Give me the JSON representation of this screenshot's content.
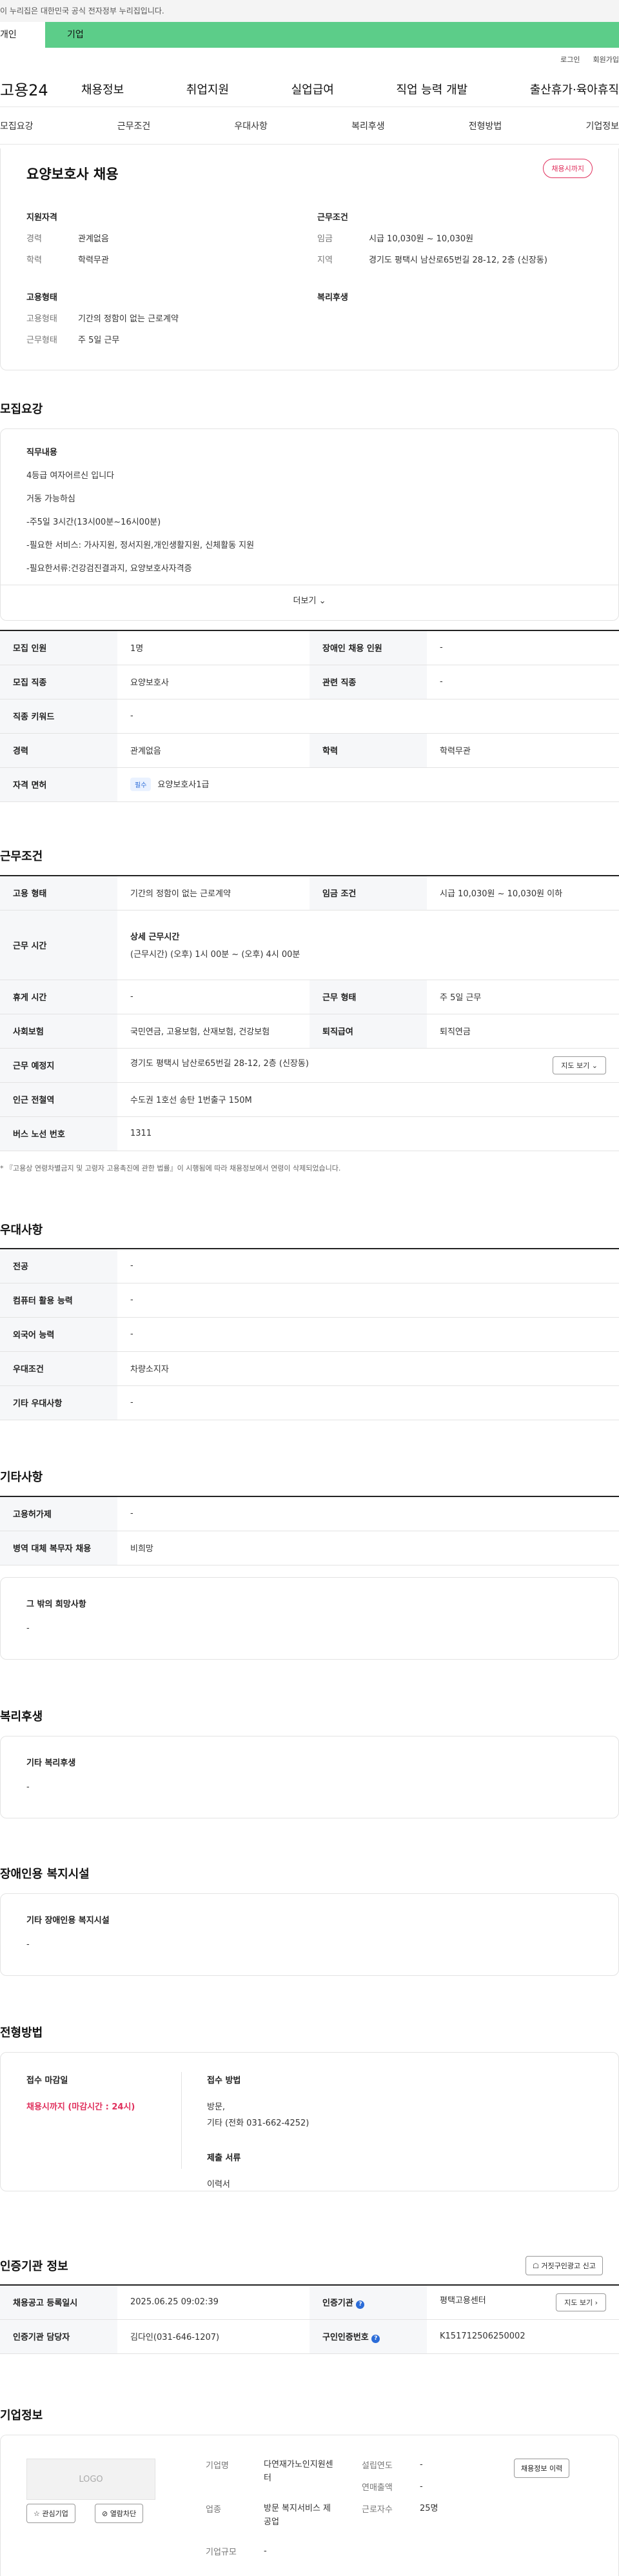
{
  "notice": "이 누리집은 대한민국 공식 전자정부 누리집입니다.",
  "top_tabs": [
    "개인",
    "기업"
  ],
  "utility": [
    "로그인",
    "회원가입"
  ],
  "logo": "고용24",
  "gnb": [
    "채용정보",
    "취업지원",
    "실업급여",
    "직업 능력 개발",
    "출산휴가·육아휴직"
  ],
  "subnav": [
    "모집요강",
    "근무조건",
    "우대사항",
    "복리후생",
    "전형방법",
    "기업정보"
  ],
  "summary": {
    "title": "요양보호사 채용",
    "badge": "채용시까지",
    "qualification": {
      "heading": "지원자격",
      "rows": [
        {
          "k": "경력",
          "v": "관계없음"
        },
        {
          "k": "학력",
          "v": "학력무관"
        }
      ]
    },
    "conditions": {
      "heading": "근무조건",
      "rows": [
        {
          "k": "임금",
          "v": "시급 10,030원 ~ 10,030원"
        },
        {
          "k": "지역",
          "v": "경기도 평택시 남산로65번길 28-12, 2층 (신장동)"
        }
      ]
    },
    "employment": {
      "heading": "고용형태",
      "rows": [
        {
          "k": "고용형태",
          "v": "기간의 정함이 없는 근로계약"
        },
        {
          "k": "근무형태",
          "v": "주 5일 근무"
        }
      ]
    },
    "welfare_heading": "복리후생"
  },
  "recruit": {
    "title": "모집요강",
    "desc_head": "직무내용",
    "desc_lines": [
      "4등급 여자어르신 입니다",
      "거동 가능하심",
      "-주5일  3시간(13시00분~16시00분)",
      "-필요한 서비스: 가사지원, 정서지원,개인생활지원, 신체활동 지원",
      "-필요한서류:건강검진결과지, 요양보호사자격증"
    ],
    "more": "더보기",
    "table": {
      "r1": {
        "k1": "모집 인원",
        "v1": "1명",
        "k2": "장애인 채용 인원",
        "v2": "-"
      },
      "r2": {
        "k1": "모집 직종",
        "v1": "요양보호사",
        "k2": "관련 직종",
        "v2": "-"
      },
      "r3": {
        "k1": "직종 키워드",
        "v1": "-"
      },
      "r4": {
        "k1": "경력",
        "v1": "관계없음",
        "k2": "학력",
        "v2": "학력무관"
      },
      "r5": {
        "k1": "자격 면허",
        "chip": "필수",
        "v1": "요양보호사1급"
      }
    }
  },
  "work": {
    "title": "근무조건",
    "r1": {
      "k1": "고용 형태",
      "v1": "기간의 정함이 없는 근로계약",
      "k2": "임금 조건",
      "v2": "시급 10,030원 ~ 10,030원 이하"
    },
    "r2": {
      "k1": "근무 시간",
      "detail_head": "상세 근무시간",
      "detail": "(근무시간) (오후) 1시 00분 ~ (오후) 4시 00분"
    },
    "r3": {
      "k1": "휴게 시간",
      "v1": "-",
      "k2": "근무 형태",
      "v2": "주 5일 근무"
    },
    "r4": {
      "k1": "사회보험",
      "v1": "국민연금, 고용보험, 산재보험, 건강보험",
      "k2": "퇴직급여",
      "v2": "퇴직연금"
    },
    "r5": {
      "k1": "근무 예정지",
      "v1": "경기도 평택시 남산로65번길 28-12, 2층 (신장동)",
      "btn": "지도 보기"
    },
    "r6": {
      "k1": "인근 전철역",
      "v1": "수도권 1호선 송탄 1번출구 150M"
    },
    "r7": {
      "k1": "버스 노선 번호",
      "v1": "1311"
    },
    "footnote": "* 『고용상 연령차별금지 및 고령자 고용촉진에 관한 법률』이 시행됨에 따라 채용정보에서 연령이 삭제되었습니다."
  },
  "pref": {
    "title": "우대사항",
    "rows": [
      {
        "k": "전공",
        "v": "-"
      },
      {
        "k": "컴퓨터 활용 능력",
        "v": "-"
      },
      {
        "k": "외국어 능력",
        "v": "-"
      },
      {
        "k": "우대조건",
        "v": "차량소지자"
      },
      {
        "k": "기타 우대사항",
        "v": "-"
      }
    ]
  },
  "etc": {
    "title": "기타사항",
    "rows": [
      {
        "k": "고용허가제",
        "v": "-"
      },
      {
        "k": "병역 대체 복무자 채용",
        "v": "비희망"
      }
    ],
    "wish_head": "그 밖의 희망사항",
    "wish_val": "-"
  },
  "welfare": {
    "title": "복리후생",
    "head": "기타 복리후생",
    "val": "-"
  },
  "disabled": {
    "title": "장애인용 복지시설",
    "head": "기타 장애인용 복지시설",
    "val": "-"
  },
  "process": {
    "title": "전형방법",
    "deadline_label": "접수 마감일",
    "deadline_value": "채용시까지 (마감시간 : 24시)",
    "method_label": "접수 방법",
    "method_value_1": "방문,",
    "method_value_2": "기타 (전화 031-662-4252)",
    "docs_label": "제출 서류",
    "docs_value": "이력서"
  },
  "cert": {
    "title": "인증기관 정보",
    "report_btn": "거짓구인광고 신고",
    "r1": {
      "k1": "채용공고 등록일시",
      "v1": "2025.06.25 09:02:39",
      "k2": "인증기관",
      "v2": "평택고용센터",
      "btn": "지도 보기"
    },
    "r2": {
      "k1": "인증기관 담당자",
      "v1": "김다인(031-646-1207)",
      "k2": "구인인증번호",
      "v2": "K151712506250002"
    }
  },
  "company": {
    "title": "기업정보",
    "logo": "LOGO",
    "fav_btn": "관심기업",
    "block_btn": "열람차단",
    "name_k": "기업명",
    "name_v": "다연재가노인지원센터",
    "industry_k": "업종",
    "industry_v": "방문 복지서비스 제공업",
    "size_k": "기업규모",
    "size_v": "-",
    "founded_k": "설립연도",
    "founded_v": "-",
    "sales_k": "연매출액",
    "sales_v": "-",
    "emp_k": "근로자수",
    "emp_v": "25명",
    "history_btn": "채용정보 이력"
  }
}
